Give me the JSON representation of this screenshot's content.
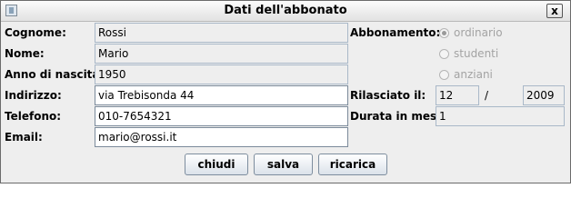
{
  "window": {
    "title": "Dati dell'abbonato",
    "close_label": "x"
  },
  "form": {
    "cognome": {
      "label": "Cognome:",
      "value": "Rossi"
    },
    "nome": {
      "label": "Nome:",
      "value": "Mario"
    },
    "anno": {
      "label": "Anno di nascita:",
      "value": "1950"
    },
    "indirizzo": {
      "label": "Indirizzo:",
      "value": "via Trebisonda 44"
    },
    "telefono": {
      "label": "Telefono:",
      "value": "010-7654321"
    },
    "email": {
      "label": "Email:",
      "value": "mario@rossi.it"
    }
  },
  "abbonamento": {
    "label": "Abbonamento:",
    "options": [
      "ordinario",
      "studenti",
      "anziani"
    ],
    "selected": "ordinario"
  },
  "rilasciato": {
    "label": "Rilasciato il:",
    "month": "12",
    "separator": "/",
    "year": "2009"
  },
  "durata": {
    "label": "Durata in mesi:",
    "value": "1"
  },
  "buttons": {
    "chiudi": "chiudi",
    "salva": "salva",
    "ricarica": "ricarica"
  }
}
